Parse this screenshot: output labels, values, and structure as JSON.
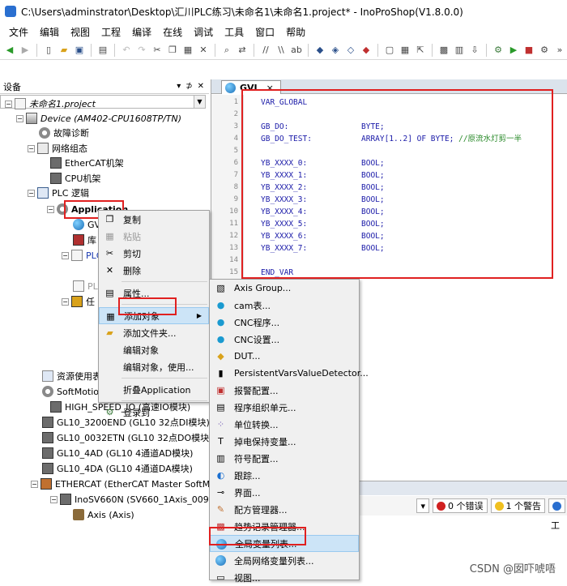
{
  "window": {
    "title": "C:\\Users\\adminstrator\\Desktop\\汇川PLC练习\\未命名1\\未命名1.project* - InoProShop(V1.8.0.0)"
  },
  "menu": [
    "文件",
    "编辑",
    "视图",
    "工程",
    "编译",
    "在线",
    "调试",
    "工具",
    "窗口",
    "帮助"
  ],
  "devices_panel": {
    "title": "设备",
    "controls": [
      "▾",
      "⊅",
      "✕"
    ],
    "tree": [
      {
        "label": "未命名1.project",
        "italic": true
      },
      {
        "label": "Device (AM402-CPU1608TP/TN)",
        "italic": true
      },
      {
        "label": "故障诊断"
      },
      {
        "label": "网络组态"
      },
      {
        "label": "EtherCAT机架"
      },
      {
        "label": "CPU机架"
      },
      {
        "label": "PLC 逻辑"
      },
      {
        "label": "Application"
      },
      {
        "label": "GV"
      },
      {
        "label": "库"
      },
      {
        "label": "PLC"
      },
      {
        "label": "PLC"
      },
      {
        "label": "任"
      },
      {
        "label": "资源使用表"
      },
      {
        "label": "SoftMotion"
      },
      {
        "label": "HIGH_SPEED_IO (高速IO模块)"
      },
      {
        "label": "GL10_3200END (GL10 32点DI模块)"
      },
      {
        "label": "GL10_0032ETN (GL10 32点DO模块)"
      },
      {
        "label": "GL10_4AD (GL10 4通道AD模块)"
      },
      {
        "label": "GL10_4DA (GL10 4通道DA模块)"
      },
      {
        "label": "ETHERCAT (EtherCAT Master SoftMotion)"
      },
      {
        "label": "InoSV660N (SV660_1Axis_00915)"
      },
      {
        "label": "Axis (Axis)"
      }
    ]
  },
  "context_menu": [
    {
      "label": "复制",
      "icon": "copy-icon"
    },
    {
      "label": "粘贴",
      "icon": "paste-icon",
      "disabled": true
    },
    {
      "label": "剪切",
      "icon": "cut-icon"
    },
    {
      "label": "删除",
      "icon": "delete-icon"
    },
    {
      "label": "属性...",
      "icon": "properties-icon"
    },
    {
      "label": "添加对象",
      "icon": "add-object-icon",
      "highlight": true
    },
    {
      "label": "添加文件夹...",
      "icon": "folder-icon"
    },
    {
      "label": "编辑对象"
    },
    {
      "label": "编辑对象，使用..."
    },
    {
      "label": "折叠Application"
    },
    {
      "label": "登录到",
      "icon": "login-icon"
    }
  ],
  "submenu": [
    "Axis Group...",
    "cam表...",
    "CNC程序...",
    "CNC设置...",
    "DUT...",
    "PersistentVarsValueDetector...",
    "报警配置...",
    "程序组织单元...",
    "单位转换...",
    "掉电保持变量...",
    "符号配置...",
    "跟踪...",
    "界面...",
    "配方管理器...",
    "趋势记录管理器...",
    "全局变量列表...",
    "全局网络变量列表...",
    "视图..."
  ],
  "editor": {
    "tab": "GVL",
    "close": "×",
    "lines": [
      {
        "n": "1",
        "a": "VAR_GLOBAL",
        "b": ""
      },
      {
        "n": "2",
        "a": "",
        "b": ""
      },
      {
        "n": "3",
        "a": "GB_DO:",
        "b": "BYTE;"
      },
      {
        "n": "4",
        "a": "GB_DO_TEST:",
        "b": "ARRAY[1..2] OF BYTE;",
        "c": " //原流水灯剪一半"
      },
      {
        "n": "5",
        "a": "",
        "b": ""
      },
      {
        "n": "6",
        "a": "YB_XXXX_0:",
        "b": "BOOL;"
      },
      {
        "n": "7",
        "a": "YB_XXXX_1:",
        "b": "BOOL;"
      },
      {
        "n": "8",
        "a": "YB_XXXX_2:",
        "b": "BOOL;"
      },
      {
        "n": "9",
        "a": "YB_XXXX_3:",
        "b": "BOOL;"
      },
      {
        "n": "10",
        "a": "YB_XXXX_4:",
        "b": "BOOL;"
      },
      {
        "n": "11",
        "a": "YB_XXXX_5:",
        "b": "BOOL;"
      },
      {
        "n": "12",
        "a": "YB_XXXX_6:",
        "b": "BOOL;"
      },
      {
        "n": "13",
        "a": "YB_XXXX_7:",
        "b": "BOOL;"
      },
      {
        "n": "14",
        "a": "",
        "b": ""
      },
      {
        "n": "15",
        "a": "END_VAR",
        "b": ""
      }
    ]
  },
  "messages": {
    "errors": "0 个错误",
    "warnings": "1 个警告",
    "col": "工"
  },
  "watermark": "CSDN @囡吓唬唔",
  "colors": {
    "highlight_red": "#e02020",
    "menu_hl": "#cce4f7",
    "code_keyword": "#1a1aa8",
    "comment": "#2a8a2a"
  }
}
